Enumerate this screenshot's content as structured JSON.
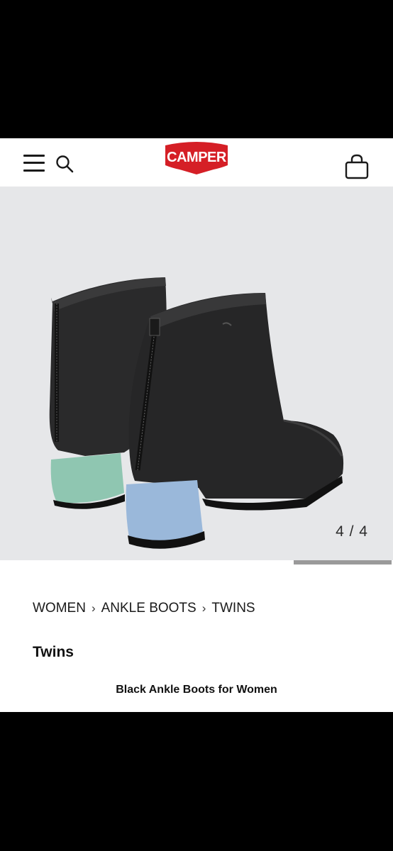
{
  "header": {
    "logo_text": "CAMPER",
    "brand_color": "#d51f26",
    "icons": [
      "menu-icon",
      "search-icon",
      "shopping-bag-icon"
    ]
  },
  "gallery": {
    "counter": "4 / 4",
    "current": 4,
    "total": 4,
    "progress": 0.25,
    "heel_colors": [
      "#8fc6b1",
      "#9ab8da"
    ]
  },
  "breadcrumb": {
    "items": [
      "WOMEN",
      "ANKLE BOOTS",
      "TWINS"
    ],
    "separator": "›"
  },
  "product": {
    "name": "Twins",
    "subtitle": "Black Ankle Boots for Women"
  }
}
